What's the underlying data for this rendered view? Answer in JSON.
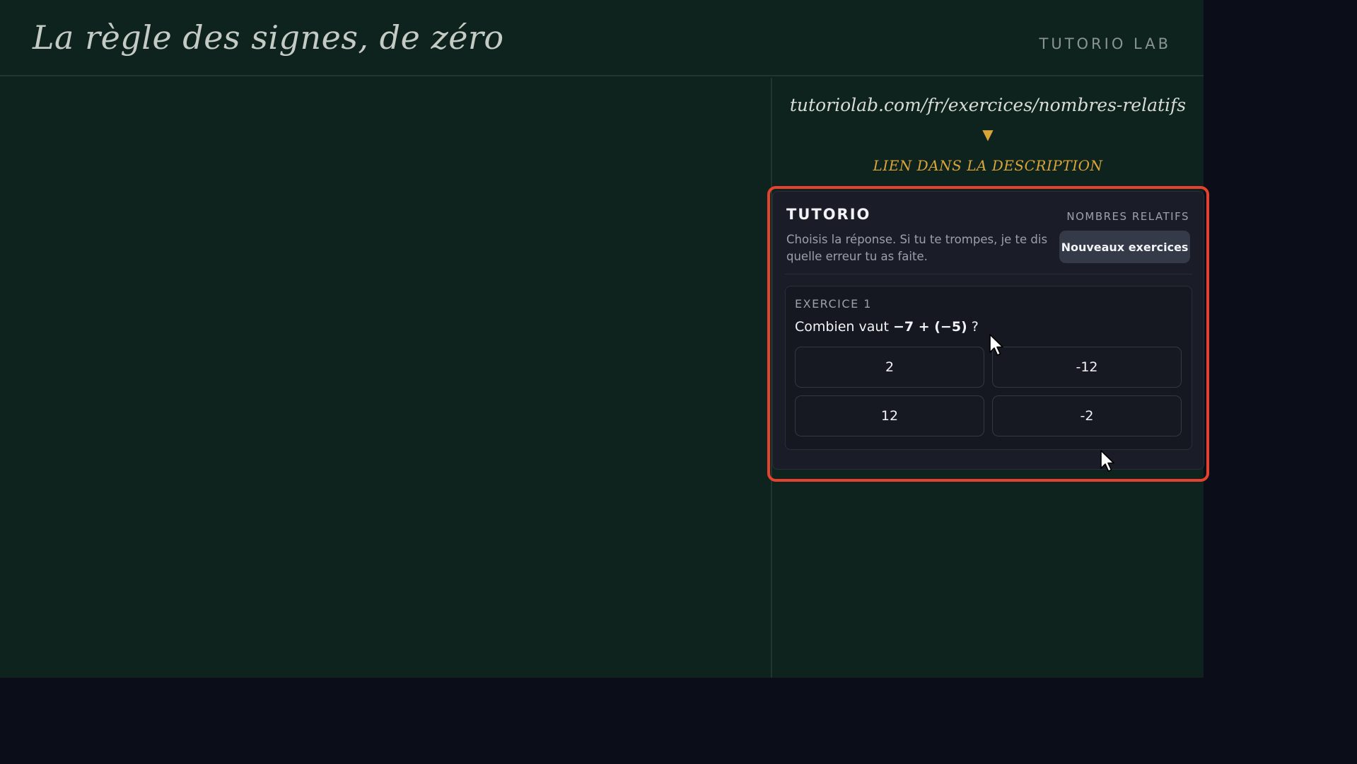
{
  "header": {
    "title": "La règle des signes, de zéro",
    "brand": "TUTORIO LAB"
  },
  "sidebar": {
    "url": "tutoriolab.com/fr/exercices/nombres-relatifs",
    "arrow": "▼",
    "link_note": "LIEN DANS LA DESCRIPTION"
  },
  "widget": {
    "title": "TUTORIO",
    "topic": "NOMBRES RELATIFS",
    "description": "Choisis la réponse. Si tu te trompes, je te dis quelle erreur tu as faite.",
    "new_button": "Nouveaux exercices",
    "exercise": {
      "label": "EXERCICE 1",
      "question_prefix": "Combien vaut",
      "question_expr": "−7 + (−5)",
      "question_suffix": "?",
      "answers": [
        "2",
        "-12",
        "12",
        "-2"
      ]
    }
  },
  "colors": {
    "stage_bg": "#0f231e",
    "outer_bg": "#0b0e18",
    "accent_gold": "#d9a438",
    "highlight_red": "#e5412f",
    "widget_bg": "#1a1d27"
  },
  "icons": {
    "cursor": "mouse-pointer-icon"
  }
}
